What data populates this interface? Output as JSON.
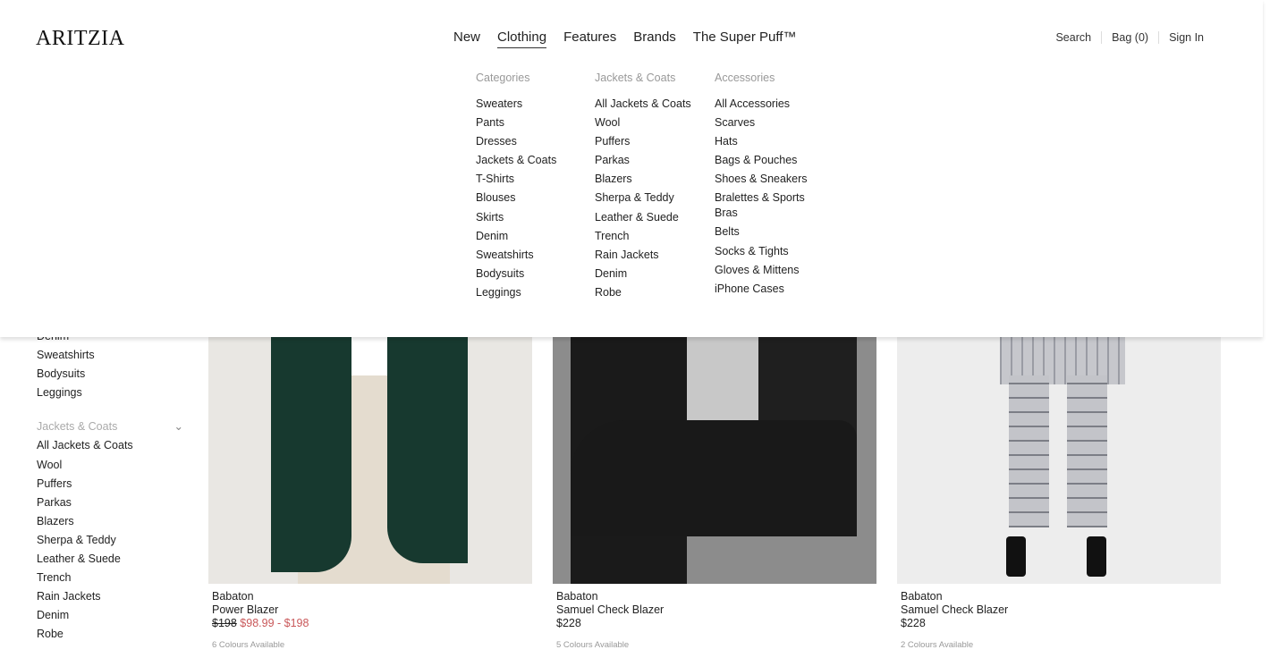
{
  "header": {
    "logo": "ARITZIA",
    "nav": [
      "New",
      "Clothing",
      "Features",
      "Brands",
      "The Super Puff™"
    ],
    "active_nav": "Clothing",
    "util": [
      "Search",
      "Bag (0)",
      "Sign In"
    ]
  },
  "mega_menu": {
    "columns": [
      {
        "heading": "Categories",
        "items": [
          "Sweaters",
          "Pants",
          "Dresses",
          "Jackets & Coats",
          "T-Shirts",
          "Blouses",
          "Skirts",
          "Denim",
          "Sweatshirts",
          "Bodysuits",
          "Leggings"
        ]
      },
      {
        "heading": "Jackets & Coats",
        "items": [
          "All Jackets & Coats",
          "Wool",
          "Puffers",
          "Parkas",
          "Blazers",
          "Sherpa & Teddy",
          "Leather & Suede",
          "Trench",
          "Rain Jackets",
          "Denim",
          "Robe"
        ]
      },
      {
        "heading": "Accessories",
        "items": [
          "All Accessories",
          "Scarves",
          "Hats",
          "Bags & Pouches",
          "Shoes & Sneakers",
          "Bralettes & Sports Bras",
          "Belts",
          "Socks & Tights",
          "Gloves & Mittens",
          "iPhone Cases"
        ]
      }
    ]
  },
  "sidebar": {
    "top_items": [
      "Denim",
      "Sweatshirts",
      "Bodysuits",
      "Leggings"
    ],
    "section": "Jackets & Coats",
    "items": [
      "All Jackets & Coats",
      "Wool",
      "Puffers",
      "Parkas",
      "Blazers",
      "Sherpa & Teddy",
      "Leather & Suede",
      "Trench",
      "Rain Jackets",
      "Denim",
      "Robe"
    ]
  },
  "products": [
    {
      "brand": "Babaton",
      "name": "Power Blazer",
      "price_original": "$198",
      "price_sale": "$98.99 - $198",
      "colors": "6 Colours Available"
    },
    {
      "brand": "Babaton",
      "name": "Samuel Check Blazer",
      "price": "$228",
      "colors": "5 Colours Available"
    },
    {
      "brand": "Babaton",
      "name": "Samuel Check Blazer",
      "price": "$228",
      "colors": "2 Colours Available"
    }
  ],
  "colors": {
    "sale": "#c9585a",
    "muted": "#999999"
  }
}
